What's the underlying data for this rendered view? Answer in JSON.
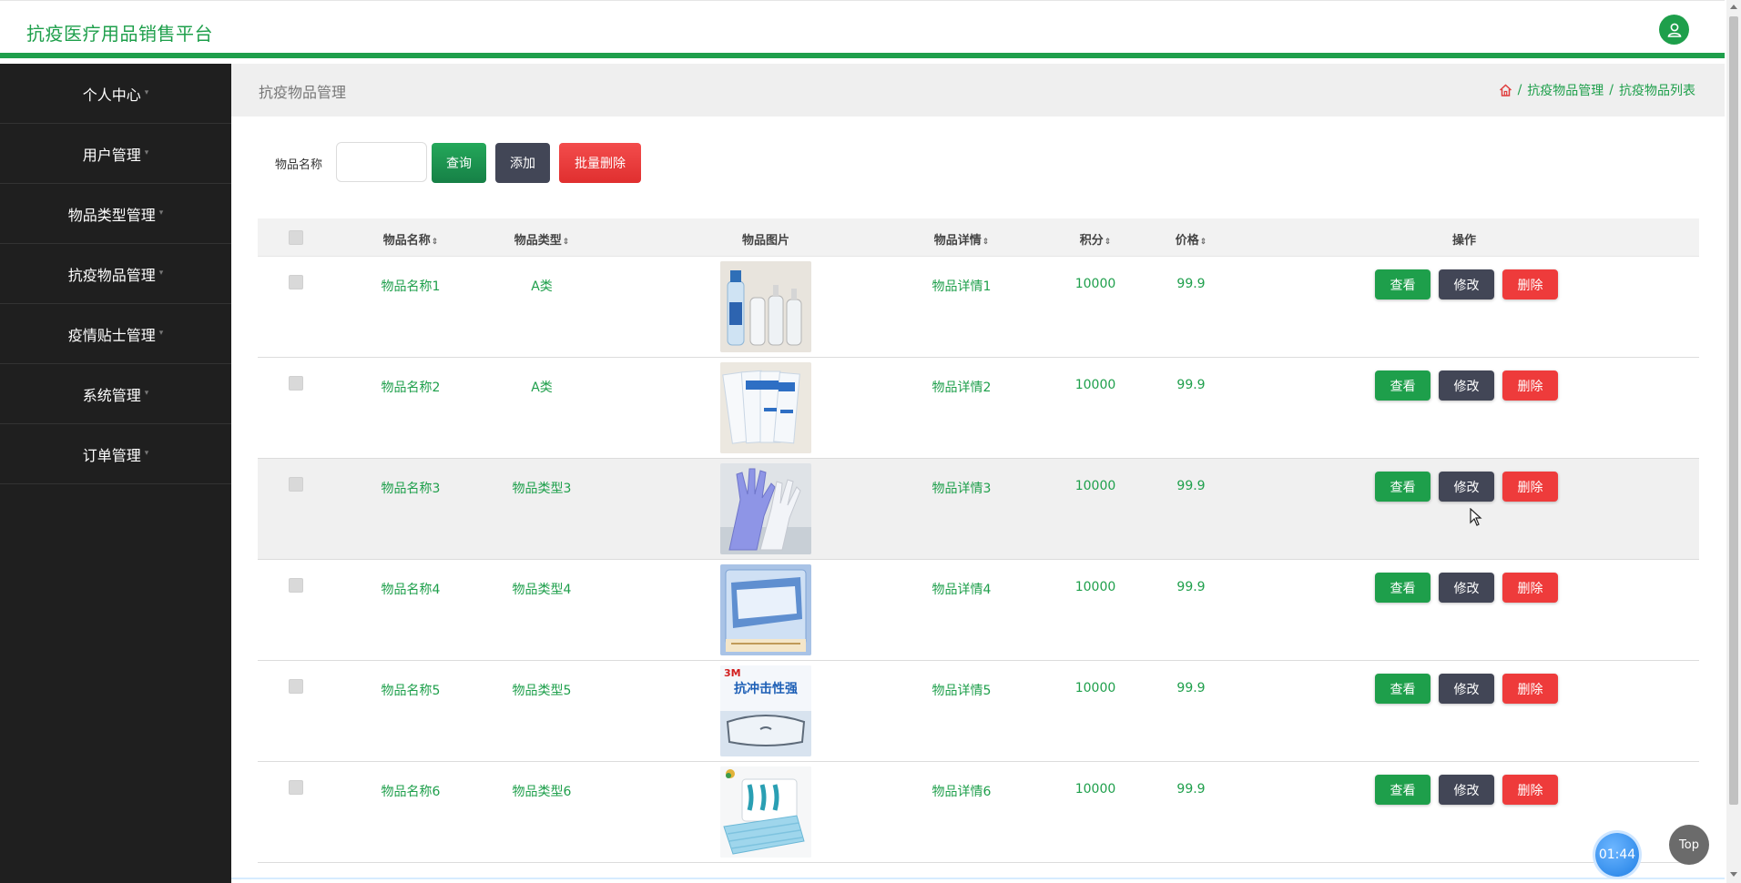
{
  "app": {
    "title": "抗疫医疗用品销售平台"
  },
  "colors": {
    "brand": "#1e9f4b",
    "sidebar": "#1f1f1f",
    "danger": "#ee3b3b",
    "neutral": "#424656"
  },
  "sidebar": {
    "items": [
      {
        "label": "个人中心"
      },
      {
        "label": "用户管理"
      },
      {
        "label": "物品类型管理"
      },
      {
        "label": "抗疫物品管理"
      },
      {
        "label": "疫情贴士管理"
      },
      {
        "label": "系统管理"
      },
      {
        "label": "订单管理"
      }
    ]
  },
  "breadcrumb": {
    "page_title": "抗疫物品管理",
    "home_icon": "home-icon",
    "items": [
      "抗疫物品管理",
      "抗疫物品列表"
    ]
  },
  "search": {
    "label": "物品名称",
    "value": "",
    "placeholder": "",
    "query_label": "查询",
    "add_label": "添加",
    "bulk_delete_label": "批量删除"
  },
  "table": {
    "columns": [
      "物品名称",
      "物品类型",
      "物品图片",
      "物品详情",
      "积分",
      "价格",
      "操作"
    ],
    "sortable_icon": "sort-icon",
    "rows": [
      {
        "name": "物品名称1",
        "type": "A类",
        "image": "sanitizer-bottles",
        "detail": "物品详情1",
        "points": "10000",
        "price": "99.9"
      },
      {
        "name": "物品名称2",
        "type": "A类",
        "image": "mask-packets",
        "detail": "物品详情2",
        "points": "10000",
        "price": "99.9"
      },
      {
        "name": "物品名称3",
        "type": "物品类型3",
        "image": "gloves",
        "detail": "物品详情3",
        "points": "10000",
        "price": "99.9"
      },
      {
        "name": "物品名称4",
        "type": "物品类型4",
        "image": "mask-bag",
        "detail": "物品详情4",
        "points": "10000",
        "price": "99.9"
      },
      {
        "name": "物品名称5",
        "type": "物品类型5",
        "image": "goggles-box",
        "detail": "物品详情5",
        "points": "10000",
        "price": "99.9"
      },
      {
        "name": "物品名称6",
        "type": "物品类型6",
        "image": "surgical-masks",
        "detail": "物品详情6",
        "points": "10000",
        "price": "99.9"
      }
    ],
    "actions": {
      "view": "查看",
      "edit": "修改",
      "delete": "删除"
    }
  },
  "thumb_text": {
    "goggles_brand": "3M",
    "goggles_caption": "抗冲击性强"
  },
  "widgets": {
    "timer": "01:44",
    "top": "Top"
  }
}
